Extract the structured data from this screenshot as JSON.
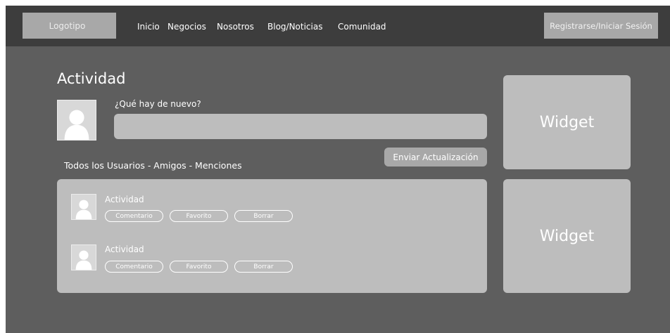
{
  "header": {
    "logo_label": "Logotipo",
    "nav": [
      "Inicio",
      "Negocios",
      "Nosotros",
      "Blog/Noticias",
      "Comunidad"
    ],
    "register_label": "Registrarse/Iniciar Sesión"
  },
  "main": {
    "title": "Actividad",
    "prompt_label": "¿Qué hay de nuevo?",
    "update_value": "",
    "send_button": "Enviar Actualización",
    "filters_text": "Todos los Usuarios - Amigos - Menciones",
    "activities": [
      {
        "title": "Actividad",
        "comment": "Comentario",
        "favorite": "Favorito",
        "delete": "Borrar"
      },
      {
        "title": "Actividad",
        "comment": "Comentario",
        "favorite": "Favorito",
        "delete": "Borrar"
      }
    ]
  },
  "sidebar": {
    "widgets": [
      "Widget",
      "Widget"
    ]
  },
  "colors": {
    "header_bg": "#3d3d3d",
    "page_bg": "#5e5e5e",
    "panel_bg": "#bdbdbd",
    "button_bg": "#a8a8a8"
  }
}
